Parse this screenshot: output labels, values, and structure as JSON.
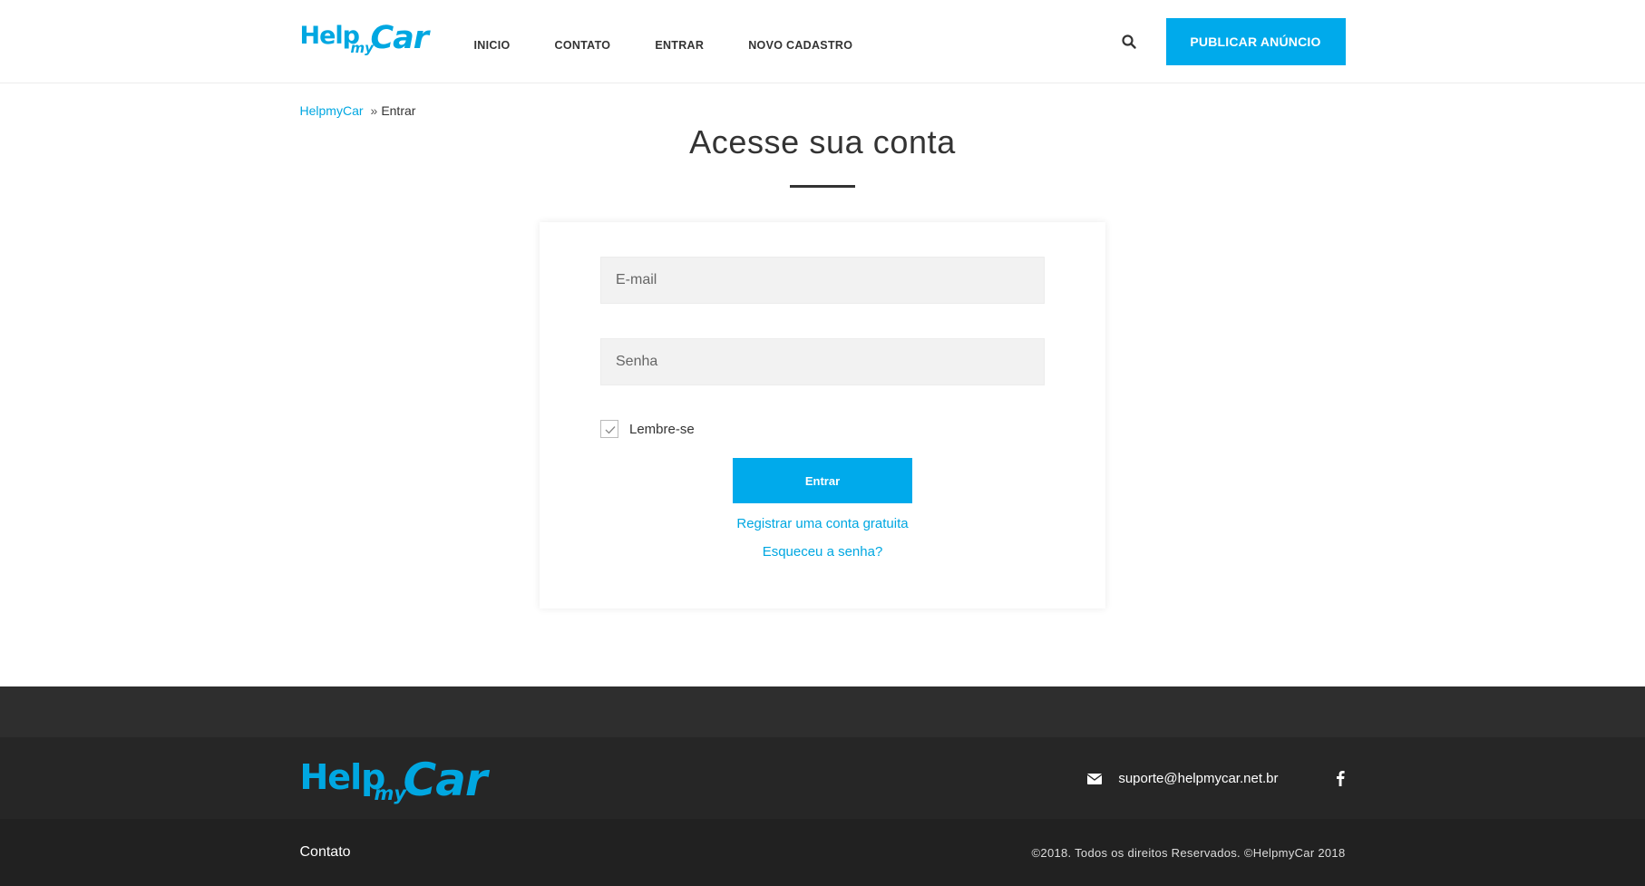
{
  "header": {
    "logo": {
      "help": "Help",
      "my": "my",
      "car": "Car"
    },
    "nav": [
      "INICIO",
      "CONTATO",
      "ENTRAR",
      "NOVO CADASTRO"
    ],
    "search_icon": "search-icon",
    "publish_label": "PUBLICAR ANÚNCIO"
  },
  "breadcrumb": {
    "home": "HelpmyCar",
    "separator": "»",
    "current": "Entrar"
  },
  "page": {
    "title": "Acesse sua conta"
  },
  "login": {
    "email_placeholder": "E-mail",
    "password_placeholder": "Senha",
    "remember_label": "Lembre-se",
    "remember_checked": true,
    "submit_label": "Entrar",
    "register_link": "Registrar uma conta gratuita",
    "forgot_link": "Esqueceu a senha?"
  },
  "footer": {
    "logo": {
      "help": "Help",
      "my": "my",
      "car": "Car"
    },
    "email_icon": "envelope-icon",
    "email": "suporte@helpmycar.net.br",
    "social_icon": "facebook-icon",
    "contact_link": "Contato",
    "copyright": "©2018. Todos os direitos Reservados. ©HelpmyCar 2018"
  },
  "colors": {
    "accent": "#00aaeb",
    "footer_dark": "#262626",
    "footer_darker": "#212121"
  }
}
